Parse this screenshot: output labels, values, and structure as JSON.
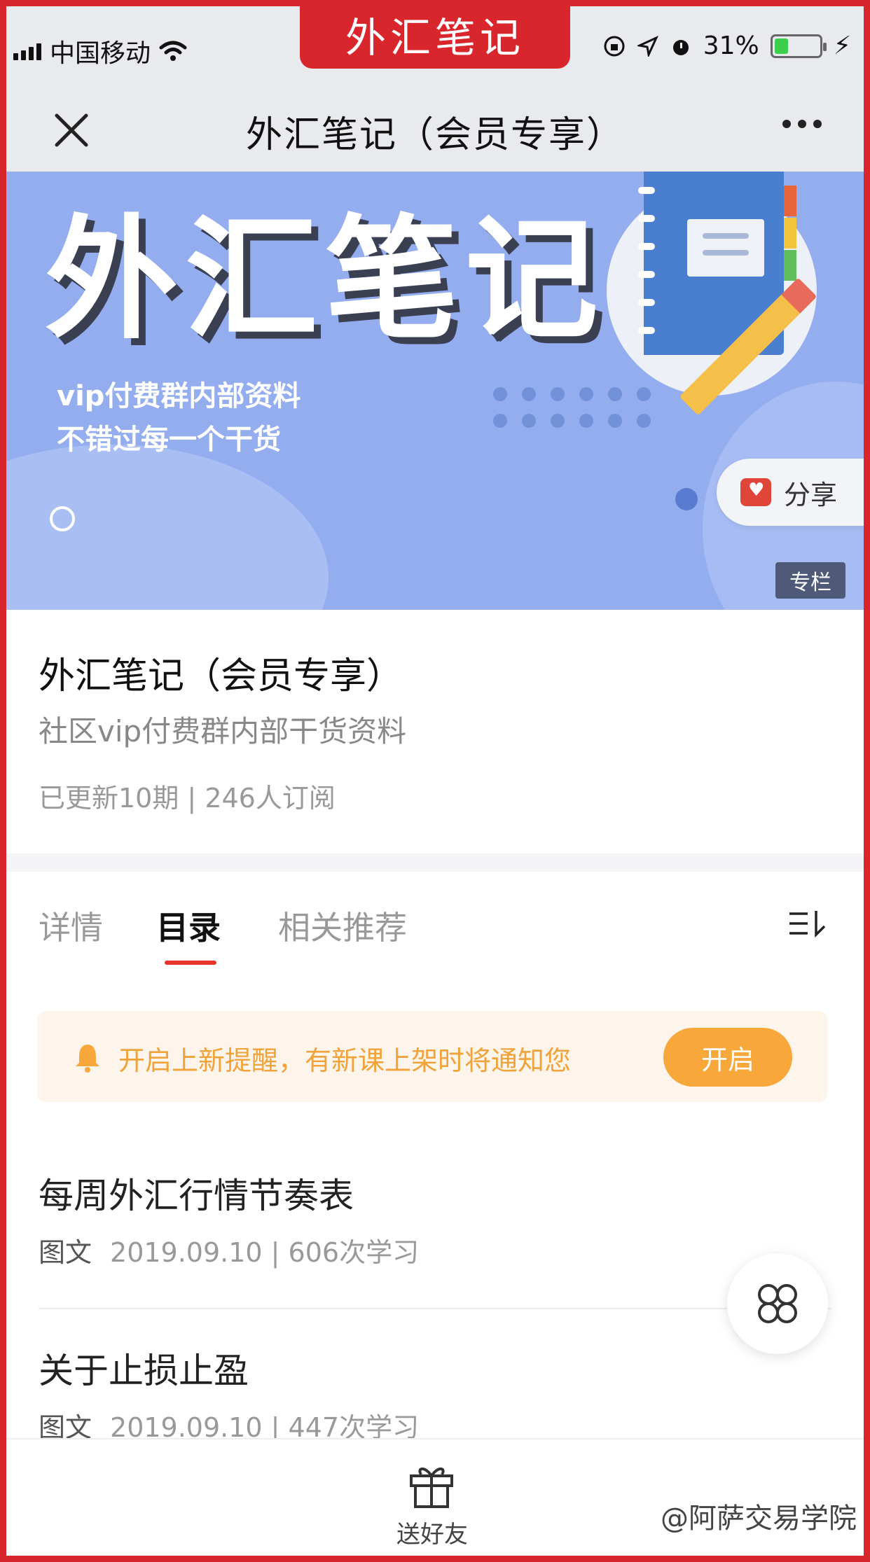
{
  "status_bar": {
    "carrier": "中国移动",
    "battery": "31%",
    "battery_level": 0.31
  },
  "header_tag": "外汇笔记",
  "nav": {
    "title": "外汇笔记（会员专享）"
  },
  "banner": {
    "title": "外汇笔记",
    "subtitle_line1": "vip付费群内部资料",
    "subtitle_line2": "不错过每一个干货",
    "share_label": "分享",
    "badge": "专栏",
    "colors": {
      "background": "#93adef",
      "accent": "#4a7fd0"
    }
  },
  "info": {
    "title": "外汇笔记（会员专享）",
    "subtitle": "社区vip付费群内部干货资料",
    "meta": "已更新10期 | 246人订阅"
  },
  "tabs": [
    {
      "label": "详情"
    },
    {
      "label": "目录"
    },
    {
      "label": "相关推荐"
    }
  ],
  "active_tab": "目录",
  "notice": {
    "text": "开启上新提醒，有新课上架时将通知您",
    "button": "开启"
  },
  "list": [
    {
      "title": "每周外汇行情节奏表",
      "type": "图文",
      "meta": "2019.09.10 | 606次学习"
    },
    {
      "title": "关于止损止盈",
      "type": "图文",
      "meta": "2019.09.10 | 447次学习"
    }
  ],
  "bottom_bar": {
    "gift_label": "送好友",
    "watermark": "@阿萨交易学院"
  },
  "colors": {
    "frame": "#d9262c",
    "tab_indicator": "#e8352b",
    "notice_button": "#f8a73a"
  }
}
